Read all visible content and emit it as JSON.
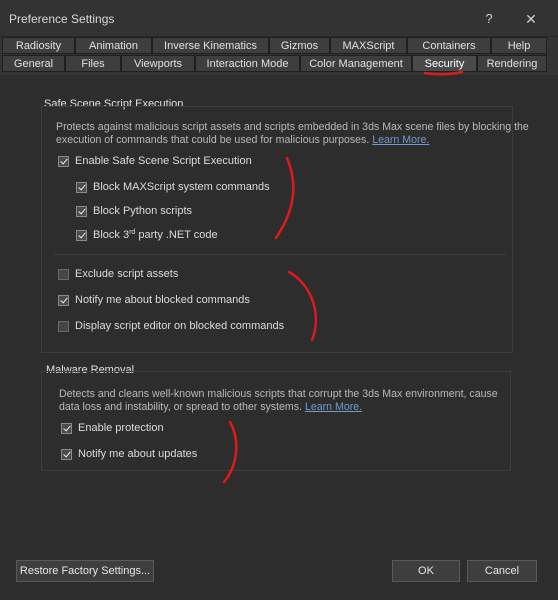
{
  "window": {
    "title": "Preference Settings",
    "help_label": "?",
    "close_label": "✕"
  },
  "tabs": {
    "row1": [
      "Radiosity",
      "Animation",
      "Inverse Kinematics",
      "Gizmos",
      "MAXScript",
      "Containers",
      "Help"
    ],
    "row2": [
      "General",
      "Files",
      "Viewports",
      "Interaction Mode",
      "Color Management",
      "Security",
      "Rendering"
    ],
    "active": "Security"
  },
  "safe_scene": {
    "title": "Safe Scene Script Execution",
    "description_1": "Protects against malicious script assets and scripts embedded in 3ds Max scene files by blocking the",
    "description_2": "execution of commands that could be used for malicious purposes.",
    "learn_more": "Learn More.",
    "enable_label": "Enable Safe Scene Script Execution",
    "enable_checked": true,
    "block_maxscript_label": "Block MAXScript system commands",
    "block_maxscript_checked": true,
    "block_python_label": "Block Python scripts",
    "block_python_checked": true,
    "block_3rd_prefix": "Block 3",
    "block_3rd_sup": "rd",
    "block_3rd_suffix": " party .NET code",
    "block_3rd_checked": true,
    "exclude_assets_label": "Exclude script assets",
    "exclude_assets_checked": false,
    "notify_blocked_label": "Notify me about blocked commands",
    "notify_blocked_checked": true,
    "display_editor_label": "Display script editor on blocked commands",
    "display_editor_checked": false
  },
  "malware": {
    "title": "Malware Removal",
    "description_1": "Detects and cleans well-known malicious scripts that corrupt the 3ds Max environment, cause",
    "description_2": "data loss and instability, or spread to other systems.",
    "learn_more": "Learn More.",
    "enable_label": "Enable protection",
    "enable_checked": true,
    "notify_updates_label": "Notify me about updates",
    "notify_updates_checked": true
  },
  "footer": {
    "restore_label": "Restore Factory Settings...",
    "ok_label": "OK",
    "cancel_label": "Cancel"
  },
  "colors": {
    "annotation_red": "#e0191b",
    "link_blue": "#6e9bd1"
  }
}
